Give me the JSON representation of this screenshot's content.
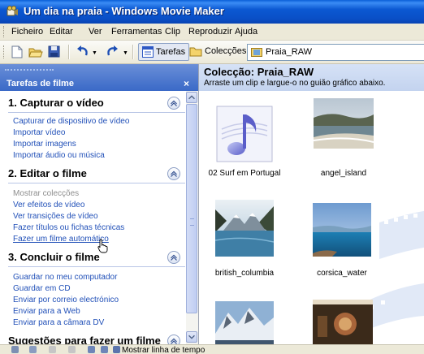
{
  "window": {
    "title": "Um dia na praia - Windows Movie Maker"
  },
  "menu": {
    "items": [
      "Ficheiro",
      "Editar",
      "Ver",
      "Ferramentas",
      "Clip",
      "Reproduzir",
      "Ajuda"
    ]
  },
  "toolbar": {
    "tasks_label": "Tarefas",
    "collections_label": "Colecções",
    "collection_select": "Praia_RAW",
    "icons": [
      "new-project-icon",
      "open-project-icon",
      "save-project-icon",
      "undo-icon",
      "redo-icon"
    ]
  },
  "task_pane": {
    "title": "Tarefas de filme",
    "close_glyph": "×",
    "sections": [
      {
        "title": "1. Capturar o vídeo",
        "links": [
          {
            "label": "Capturar de dispositivo de vídeo"
          },
          {
            "label": "Importar vídeo"
          },
          {
            "label": "Importar imagens"
          },
          {
            "label": "Importar áudio ou música"
          }
        ]
      },
      {
        "title": "2. Editar o filme",
        "links": [
          {
            "label": "Mostrar colecções",
            "state": "disabled"
          },
          {
            "label": "Ver efeitos de vídeo"
          },
          {
            "label": "Ver transições de vídeo"
          },
          {
            "label": "Fazer títulos ou fichas técnicas"
          },
          {
            "label": "Fazer um filme automático",
            "state": "hover"
          }
        ]
      },
      {
        "title": "3. Concluir o filme",
        "links": [
          {
            "label": "Guardar no meu computador"
          },
          {
            "label": "Guardar em CD"
          },
          {
            "label": "Enviar por correio electrónico"
          },
          {
            "label": "Enviar para a Web"
          },
          {
            "label": "Enviar para a câmara DV"
          }
        ]
      },
      {
        "title": "Sugestões para fazer um filme",
        "links": []
      }
    ]
  },
  "collection": {
    "title": "Colecção: Praia_RAW",
    "subtitle": "Arraste um clip e largue-o no guião gráfico abaixo.",
    "clips": [
      {
        "name": "02 Surf em Portugal",
        "kind": "audio"
      },
      {
        "name": "angel_island",
        "kind": "image"
      },
      {
        "name": "british_columbia",
        "kind": "image"
      },
      {
        "name": "corsica_water",
        "kind": "image"
      },
      {
        "name": "",
        "kind": "image"
      },
      {
        "name": "",
        "kind": "image"
      }
    ]
  },
  "statusbar": {
    "text": "Mostrar linha de tempo"
  },
  "colors": {
    "titlebar": "#0b58d2",
    "link": "#2150b8",
    "task_header": "#3a69c7"
  }
}
